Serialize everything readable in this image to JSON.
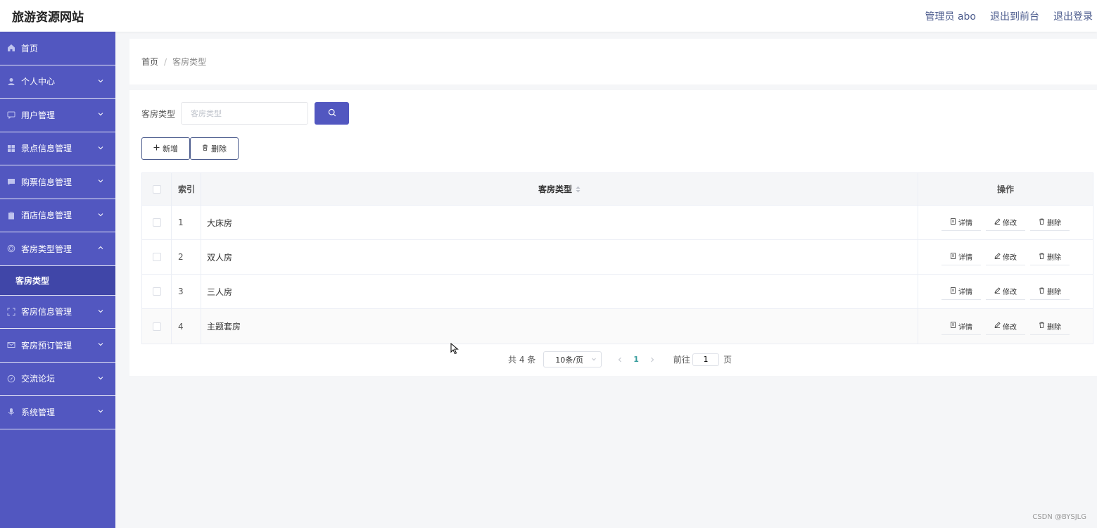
{
  "header": {
    "title": "旅游资源网站",
    "links": [
      "管理员 abo",
      "退出到前台",
      "退出登录"
    ]
  },
  "sidebar": {
    "items": [
      {
        "label": "首页",
        "icon": "home-icon",
        "has_chevron": false
      },
      {
        "label": "个人中心",
        "icon": "user-icon",
        "has_chevron": true
      },
      {
        "label": "用户管理",
        "icon": "chat-icon",
        "has_chevron": true
      },
      {
        "label": "景点信息管理",
        "icon": "grid-icon",
        "has_chevron": true
      },
      {
        "label": "购票信息管理",
        "icon": "message-icon",
        "has_chevron": true
      },
      {
        "label": "酒店信息管理",
        "icon": "clipboard-icon",
        "has_chevron": true
      },
      {
        "label": "客房类型管理",
        "icon": "circle-icon",
        "has_chevron": true,
        "expanded": true
      },
      {
        "label": "客房信息管理",
        "icon": "frame-icon",
        "has_chevron": true
      },
      {
        "label": "客房预订管理",
        "icon": "mail-icon",
        "has_chevron": true
      },
      {
        "label": "交流论坛",
        "icon": "compass-icon",
        "has_chevron": true
      },
      {
        "label": "系统管理",
        "icon": "mic-icon",
        "has_chevron": true
      }
    ],
    "subitem": "客房类型"
  },
  "breadcrumb": {
    "home": "首页",
    "separator": "/",
    "current": "客房类型"
  },
  "search": {
    "label": "客房类型",
    "placeholder": "客房类型",
    "value": ""
  },
  "actions": {
    "add_label": "新增",
    "delete_label": "删除"
  },
  "table": {
    "headers": {
      "index": "索引",
      "type": "客房类型",
      "ops": "操作"
    },
    "rows": [
      {
        "index": "1",
        "type": "大床房"
      },
      {
        "index": "2",
        "type": "双人房"
      },
      {
        "index": "3",
        "type": "三人房"
      },
      {
        "index": "4",
        "type": "主题套房"
      }
    ],
    "op_labels": {
      "detail": "详情",
      "edit": "修改",
      "delete": "删除"
    }
  },
  "pagination": {
    "total": "共 4 条",
    "page_size": "10条/页",
    "current_page": "1",
    "goto_label": "前往",
    "goto_value": "1",
    "page_suffix": "页"
  },
  "watermark": "CSDN @BYSJLG",
  "colors": {
    "sidebar": "#5257c0",
    "sidebar_active": "#4046a8",
    "accent": "#5257c0"
  }
}
